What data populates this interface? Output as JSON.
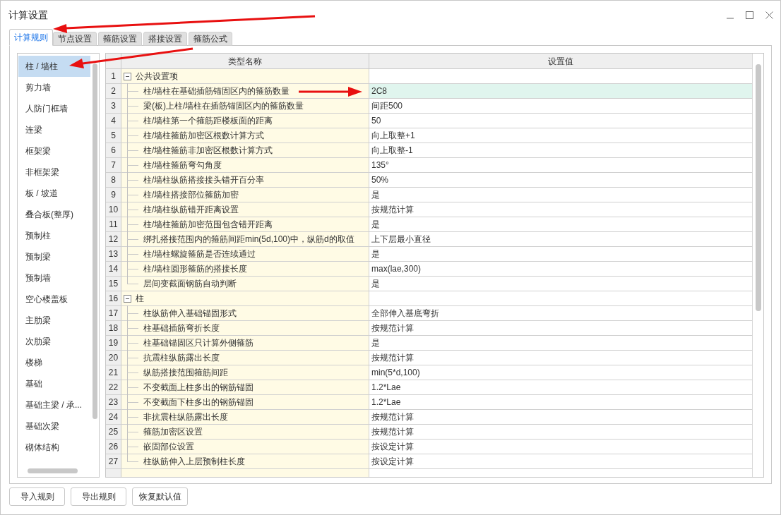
{
  "window": {
    "title": "计算设置"
  },
  "tabs": [
    {
      "label": "计算规则",
      "selected": true
    },
    {
      "label": "节点设置",
      "selected": false
    },
    {
      "label": "箍筋设置",
      "selected": false
    },
    {
      "label": "搭接设置",
      "selected": false
    },
    {
      "label": "箍筋公式",
      "selected": false
    }
  ],
  "sidebar": {
    "items": [
      {
        "label": "柱 / 墙柱",
        "selected": true
      },
      {
        "label": "剪力墙",
        "selected": false
      },
      {
        "label": "人防门框墙",
        "selected": false
      },
      {
        "label": "连梁",
        "selected": false
      },
      {
        "label": "框架梁",
        "selected": false
      },
      {
        "label": "非框架梁",
        "selected": false
      },
      {
        "label": "板 / 坡道",
        "selected": false
      },
      {
        "label": "叠合板(整厚)",
        "selected": false
      },
      {
        "label": "预制柱",
        "selected": false
      },
      {
        "label": "预制梁",
        "selected": false
      },
      {
        "label": "预制墙",
        "selected": false
      },
      {
        "label": "空心楼盖板",
        "selected": false
      },
      {
        "label": "主肋梁",
        "selected": false
      },
      {
        "label": "次肋梁",
        "selected": false
      },
      {
        "label": "楼梯",
        "selected": false
      },
      {
        "label": "基础",
        "selected": false
      },
      {
        "label": "基础主梁 / 承...",
        "selected": false
      },
      {
        "label": "基础次梁",
        "selected": false
      },
      {
        "label": "砌体结构",
        "selected": false
      }
    ]
  },
  "table": {
    "columns": [
      "类型名称",
      "设置值"
    ],
    "rows": [
      {
        "number": "1",
        "name": "公共设置项",
        "expanded": true,
        "children": [
          {
            "number": "2",
            "name": "柱/墙柱在基础插筋锚固区内的箍筋数量",
            "value": "2C8",
            "selected": true
          },
          {
            "number": "3",
            "name": "梁(板)上柱/墙柱在插筋锚固区内的箍筋数量",
            "value": "间距500",
            "selected": false
          },
          {
            "number": "4",
            "name": "柱/墙柱第一个箍筋距楼板面的距离",
            "value": "50",
            "selected": false
          },
          {
            "number": "5",
            "name": "柱/墙柱箍筋加密区根数计算方式",
            "value": "向上取整+1",
            "selected": false
          },
          {
            "number": "6",
            "name": "柱/墙柱箍筋非加密区根数计算方式",
            "value": "向上取整-1",
            "selected": false
          },
          {
            "number": "7",
            "name": "柱/墙柱箍筋弯勾角度",
            "value": "135°",
            "selected": false
          },
          {
            "number": "8",
            "name": "柱/墙柱纵筋搭接接头错开百分率",
            "value": "50%",
            "selected": false
          },
          {
            "number": "9",
            "name": "柱/墙柱搭接部位箍筋加密",
            "value": "是",
            "selected": false
          },
          {
            "number": "10",
            "name": "柱/墙柱纵筋错开距离设置",
            "value": "按规范计算",
            "selected": false
          },
          {
            "number": "11",
            "name": "柱/墙柱箍筋加密范围包含错开距离",
            "value": "是",
            "selected": false
          },
          {
            "number": "12",
            "name": "绑扎搭接范围内的箍筋间距min(5d,100)中，纵筋d的取值",
            "value": "上下层最小直径",
            "selected": false
          },
          {
            "number": "13",
            "name": "柱/墙柱螺旋箍筋是否连续通过",
            "value": "是",
            "selected": false
          },
          {
            "number": "14",
            "name": "柱/墙柱圆形箍筋的搭接长度",
            "value": "max(lae,300)",
            "selected": false
          },
          {
            "number": "15",
            "name": "层间变截面钢筋自动判断",
            "value": "是",
            "selected": false
          }
        ]
      },
      {
        "number": "16",
        "name": "柱",
        "expanded": true,
        "children": [
          {
            "number": "17",
            "name": "柱纵筋伸入基础锚固形式",
            "value": "全部伸入基底弯折",
            "selected": false
          },
          {
            "number": "18",
            "name": "柱基础插筋弯折长度",
            "value": "按规范计算",
            "selected": false
          },
          {
            "number": "19",
            "name": "柱基础锚固区只计算外侧箍筋",
            "value": "是",
            "selected": false
          },
          {
            "number": "20",
            "name": "抗震柱纵筋露出长度",
            "value": "按规范计算",
            "selected": false
          },
          {
            "number": "21",
            "name": "纵筋搭接范围箍筋间距",
            "value": "min(5*d,100)",
            "selected": false
          },
          {
            "number": "22",
            "name": "不变截面上柱多出的钢筋锚固",
            "value": "1.2*Lae",
            "selected": false
          },
          {
            "number": "23",
            "name": "不变截面下柱多出的钢筋锚固",
            "value": "1.2*Lae",
            "selected": false
          },
          {
            "number": "24",
            "name": "非抗震柱纵筋露出长度",
            "value": "按规范计算",
            "selected": false
          },
          {
            "number": "25",
            "name": "箍筋加密区设置",
            "value": "按规范计算",
            "selected": false
          },
          {
            "number": "26",
            "name": "嵌固部位设置",
            "value": "按设定计算",
            "selected": false
          },
          {
            "number": "27",
            "name": "柱纵筋伸入上层预制柱长度",
            "value": "按设定计算",
            "selected": false
          }
        ]
      }
    ]
  },
  "buttons": [
    "导入规则",
    "导出规则",
    "恢复默认值"
  ]
}
